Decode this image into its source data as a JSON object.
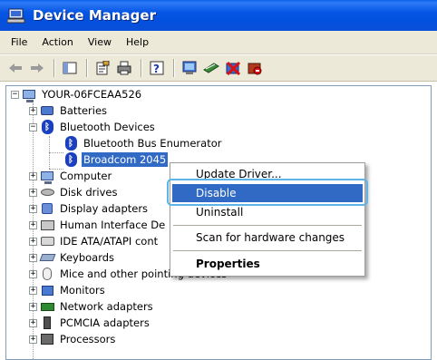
{
  "window": {
    "title": "Device Manager",
    "icon": "device-manager-icon"
  },
  "menu": [
    "File",
    "Action",
    "View",
    "Help"
  ],
  "toolbar": {
    "buttons": [
      "back-arrow-icon",
      "forward-arrow-icon",
      "show-hide-console-tree-icon",
      "properties-icon",
      "print-icon",
      "help-icon",
      "scan-hardware-icon",
      "update-driver-icon",
      "uninstall-icon",
      "disable-icon"
    ]
  },
  "tree": {
    "root": "YOUR-06FCEAA526",
    "nodes": [
      {
        "label": "Batteries",
        "icon": "battery-icon",
        "expander": "+"
      },
      {
        "label": "Bluetooth Devices",
        "icon": "bluetooth-icon",
        "expander": "−"
      },
      {
        "label": "Bluetooth Bus Enumerator",
        "icon": "bluetooth-icon"
      },
      {
        "label": "Broadcom 2045",
        "icon": "bluetooth-icon",
        "selected": true
      },
      {
        "label": "Computer",
        "icon": "computer-icon",
        "expander": "+"
      },
      {
        "label": "Disk drives",
        "icon": "disk-drive-icon",
        "expander": "+"
      },
      {
        "label": "Display adapters",
        "icon": "display-adapter-icon",
        "expander": "+"
      },
      {
        "label": "Human Interface De",
        "icon": "hid-icon",
        "expander": "+"
      },
      {
        "label": "IDE ATA/ATAPI cont",
        "icon": "ide-controller-icon",
        "expander": "+"
      },
      {
        "label": "Keyboards",
        "icon": "keyboard-icon",
        "expander": "+"
      },
      {
        "label": "Mice and other pointing devices",
        "icon": "mouse-icon",
        "expander": "+"
      },
      {
        "label": "Monitors",
        "icon": "monitor-icon",
        "expander": "+"
      },
      {
        "label": "Network adapters",
        "icon": "network-adapter-icon",
        "expander": "+"
      },
      {
        "label": "PCMCIA adapters",
        "icon": "pcmcia-icon",
        "expander": "+"
      },
      {
        "label": "Processors",
        "icon": "processor-icon",
        "expander": "+"
      }
    ]
  },
  "context_menu": {
    "items": [
      {
        "label": "Update Driver..."
      },
      {
        "label": "Disable",
        "highlighted": true
      },
      {
        "label": "Uninstall"
      },
      {
        "label": "Scan for hardware changes"
      },
      {
        "label": "Properties",
        "bold": true
      }
    ]
  },
  "colors": {
    "title_bar": "#0655e4",
    "selection": "#316ac5",
    "focus_ring": "#5bb5e8",
    "chrome": "#ece9d8"
  }
}
